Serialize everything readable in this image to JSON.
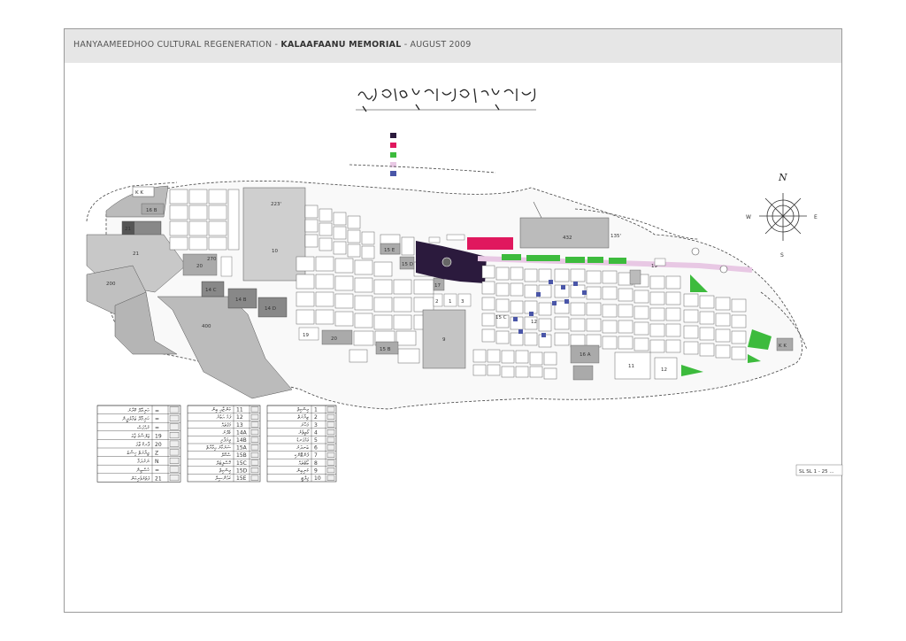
{
  "header": {
    "part1": "HANYAAMEEDHOO CULTURAL REGENERATION - ",
    "part2": "KALAAFAANU MEMORIAL",
    "part3": " - AUGUST 2009"
  },
  "legend_colors": [
    "#2b1a3d",
    "#e0185e",
    "#3dbb3d",
    "#e8c8e4",
    "#4a56a8"
  ],
  "compass": {
    "n": "N",
    "s": "S",
    "e": "E",
    "w": "W"
  },
  "map_labels": {
    "kk_west": "K K",
    "kk_east": "K K",
    "b16": "16 B",
    "b21a": "21",
    "b21b": "21",
    "b20": "20",
    "b10": "10",
    "b14c": "14 C",
    "b14b": "14 B",
    "b14d": "14 D",
    "b15e": "15 E",
    "b15d": "15 D",
    "b15b": "15 B",
    "b19a": "19",
    "b19b": "19",
    "b20b": "20",
    "b17": "17",
    "b12a": "12",
    "b12b": "12",
    "b11": "11",
    "b9": "9",
    "b3": "3",
    "b1": "1",
    "b2": "2",
    "b15c": "15 C",
    "b16a": "16 A",
    "b200": "200",
    "b270": "270",
    "b400": "400",
    "b223": "223'",
    "b432": "432",
    "b135": "135'",
    "scale_note": "SL SL 1 - 25 ..."
  },
  "legend_table_1": [
    {
      "code": "=",
      "text": "ހަނިމާދޫ ކޮށާރު"
    },
    {
      "code": "=",
      "text": "ހަނިމާދޫ ޖަމާލުދީން"
    },
    {
      "code": "=",
      "text": "ރުއްގަސް"
    },
    {
      "code": "19",
      "text": "ޖަލްސާގެ ޖާގަ"
    },
    {
      "code": "20",
      "text": "ޕާރކް ޖާގަ"
    },
    {
      "code": "Z",
      "text": "ޒިޔާރަތް ހިސާބު"
    },
    {
      "code": "N",
      "text": "ނަރުދަމާ"
    },
    {
      "code": "=",
      "text": "ހުސްބިން"
    },
    {
      "code": "21",
      "text": "ފަތުރުވެރިކަން"
    }
  ],
  "legend_table_2": [
    {
      "code": "11",
      "text": "ކަންޏާއި ބިން"
    },
    {
      "code": "12",
      "text": "ފަޅު އަބުރު"
    },
    {
      "code": "13",
      "text": "މަގުތައް"
    },
    {
      "code": "14A",
      "text": "ގެދޮރު"
    },
    {
      "code": "14B",
      "text": "ވިޔަފާރި"
    },
    {
      "code": "15A",
      "text": "ސަރުކާރު އިމާރާތް"
    },
    {
      "code": "15B",
      "text": "ސްކޫލް"
    },
    {
      "code": "15C",
      "text": "ހޮސްޕިޓަލް"
    },
    {
      "code": "15D",
      "text": "މިސްކިތް"
    },
    {
      "code": "15E",
      "text": "ކައުންސިލް"
    }
  ],
  "legend_table_3": [
    {
      "code": "1",
      "text": "މިސްކިތް"
    },
    {
      "code": "2",
      "text": "ޒިޔާރަތް"
    },
    {
      "code": "3",
      "text": "މަހާނަ"
    },
    {
      "code": "4",
      "text": "ގޯތިތެރެ"
    },
    {
      "code": "5",
      "text": "ވަޅުގަނޑު"
    },
    {
      "code": "6",
      "text": "ބަނދަރު"
    },
    {
      "code": "7",
      "text": "ފެންޓޭންކި"
    },
    {
      "code": "8",
      "text": "ބޯޓުތައް"
    },
    {
      "code": "9",
      "text": "ކުނިބިން"
    },
    {
      "code": "10",
      "text": "ގިލްޓީ"
    }
  ]
}
